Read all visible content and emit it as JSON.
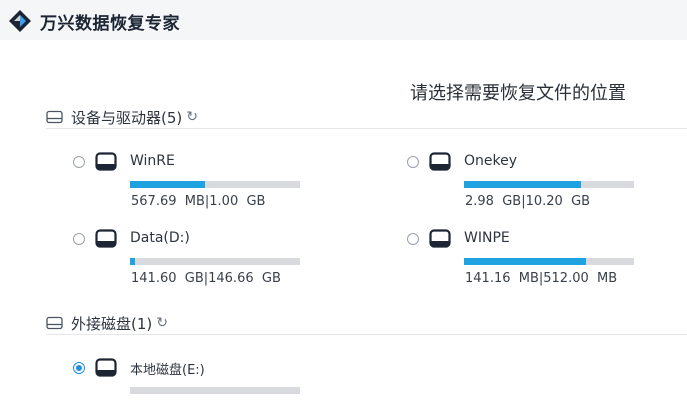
{
  "app": {
    "title": "万兴数据恢复专家"
  },
  "page": {
    "title": "请选择需要恢复文件的位置"
  },
  "sections": {
    "devices": {
      "label": "设备与驱动器(5)",
      "refresh_glyph": "↻"
    },
    "external": {
      "label": "外接磁盘(1)",
      "refresh_glyph": "↻"
    }
  },
  "drives": [
    {
      "name": "WinRE",
      "size": "567.69  MB|1.00  GB",
      "usage": 0.44,
      "selected": false
    },
    {
      "name": "Onekey",
      "size": "2.98  GB|10.20  GB",
      "usage": 0.69,
      "selected": false
    },
    {
      "name": "Data(D:)",
      "size": "141.60  GB|146.66  GB",
      "usage": 0.03,
      "selected": false
    },
    {
      "name": "WINPE",
      "size": "141.16  MB|512.00  MB",
      "usage": 0.72,
      "selected": false
    },
    {
      "name": "本地磁盘(E:)",
      "size": "",
      "usage": 0.0,
      "selected": true
    }
  ],
  "colors": {
    "accent": "#1e8fe1",
    "bar_fill": "#1ea3e0",
    "bar_track": "#d9dadd",
    "header_bg": "#f5f6f8"
  },
  "icons": [
    "logo-icon",
    "drive-group-icon",
    "refresh-icon",
    "radio",
    "disk-icon"
  ]
}
